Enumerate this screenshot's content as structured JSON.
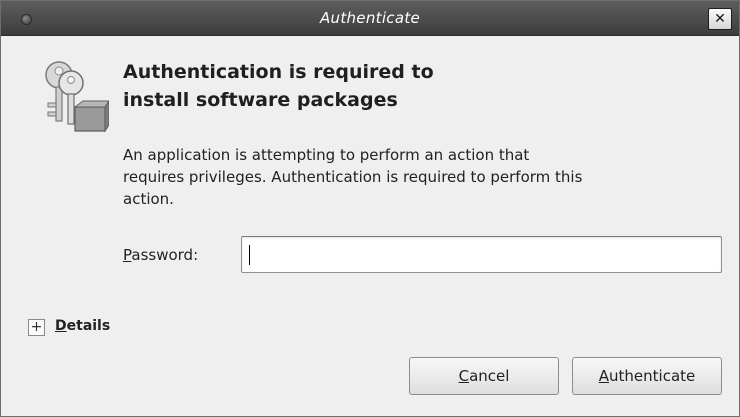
{
  "window": {
    "title": "Authenticate",
    "close_glyph": "✕"
  },
  "icon": {
    "name": "keys-icon"
  },
  "heading": {
    "line1": "Authentication is required to",
    "line2": "install software packages"
  },
  "message": {
    "line1": "An application is attempting to perform an action that",
    "line2": "requires privileges. Authentication is required to perform this",
    "line3": "action."
  },
  "password": {
    "label_mnemonic": "P",
    "label_rest": "assword:",
    "value": ""
  },
  "details": {
    "expander_glyph": "+",
    "label_mnemonic": "D",
    "label_rest": "etails"
  },
  "buttons": {
    "cancel_mnemonic": "C",
    "cancel_rest": "ancel",
    "auth_mnemonic": "A",
    "auth_rest": "uthenticate"
  },
  "colors": {
    "titlebar": "#4a4a4a",
    "dialog_bg": "#efefef"
  }
}
